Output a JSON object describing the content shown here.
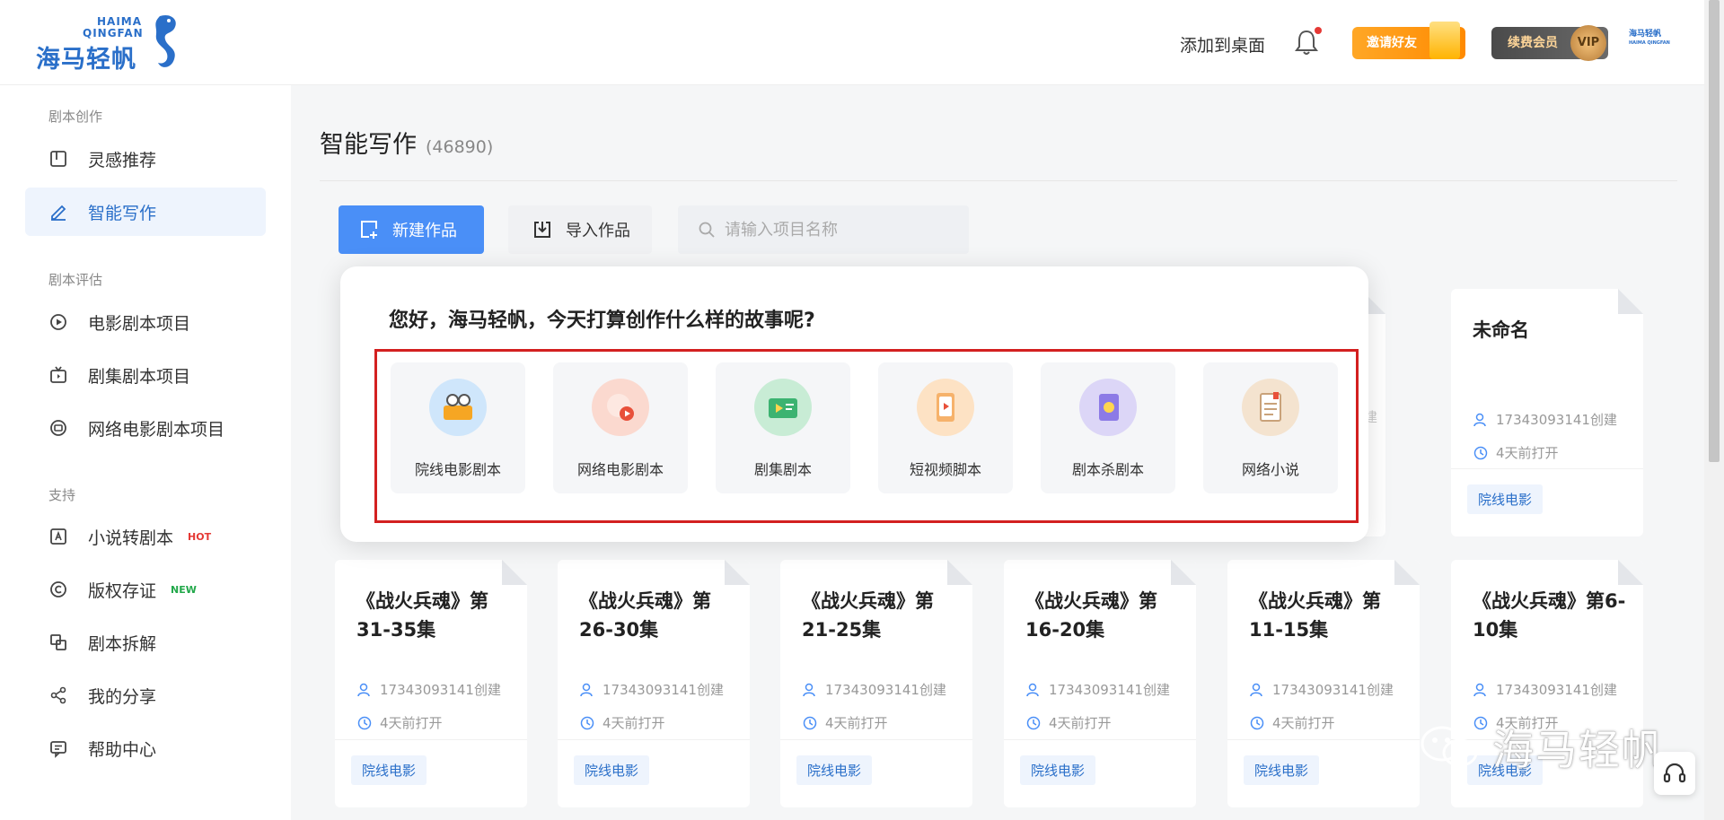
{
  "header": {
    "logo_cn": "海马轻帆",
    "logo_en_line1": "HAIMA",
    "logo_en_line2": "QINGFAN",
    "add_to_desktop": "添加到桌面",
    "invite_label": "邀请好友",
    "renew_label": "续费会员",
    "vip_badge": "VIP",
    "mini_logo_cn": "海马轻帆",
    "mini_logo_en": "HAIMA QINGFAN"
  },
  "sidebar": {
    "sections": [
      {
        "label": "剧本创作"
      },
      {
        "label": "剧本评估"
      },
      {
        "label": "支持"
      }
    ],
    "items": [
      {
        "label": "灵感推荐",
        "icon": "book-icon"
      },
      {
        "label": "智能写作",
        "icon": "pen-icon",
        "active": true
      },
      {
        "label": "电影剧本项目",
        "icon": "play-circle-icon"
      },
      {
        "label": "剧集剧本项目",
        "icon": "tv-icon"
      },
      {
        "label": "网络电影剧本项目",
        "icon": "web-video-icon"
      },
      {
        "label": "小说转剧本",
        "icon": "convert-icon",
        "tag": "HOT"
      },
      {
        "label": "版权存证",
        "icon": "copyright-icon",
        "tag": "NEW"
      },
      {
        "label": "剧本拆解",
        "icon": "split-icon"
      },
      {
        "label": "我的分享",
        "icon": "share-icon"
      },
      {
        "label": "帮助中心",
        "icon": "help-icon"
      }
    ]
  },
  "main": {
    "title": "智能写作",
    "count": "(46890)",
    "new_button": "新建作品",
    "import_button": "导入作品",
    "search_placeholder": "请输入项目名称"
  },
  "popup": {
    "greeting": "您好，海马轻帆，今天打算创作什么样的故事呢?",
    "options": [
      {
        "label": "院线电影剧本",
        "icon": "film-icon"
      },
      {
        "label": "网络电影剧本",
        "icon": "web-film-icon"
      },
      {
        "label": "剧集剧本",
        "icon": "tv-series-icon"
      },
      {
        "label": "短视频脚本",
        "icon": "short-video-icon"
      },
      {
        "label": "剧本杀剧本",
        "icon": "murder-mystery-icon"
      },
      {
        "label": "网络小说",
        "icon": "novel-icon"
      }
    ]
  },
  "cards_top": [
    {
      "title": "",
      "creator": "",
      "opened": "",
      "tag": ""
    },
    {
      "title": "",
      "creator": "",
      "opened": "",
      "tag": ""
    },
    {
      "title": "",
      "creator": "",
      "opened": "",
      "tag": ""
    },
    {
      "title": "",
      "creator": "",
      "opened": "",
      "tag": ""
    },
    {
      "title": "",
      "creator": "建",
      "opened": "",
      "tag": ""
    },
    {
      "title": "未命名",
      "creator": "17343093141创建",
      "opened": "4天前打开",
      "tag": "院线电影"
    }
  ],
  "cards_bottom": [
    {
      "title": "《战火兵魂》第31-35集",
      "creator": "17343093141创建",
      "opened": "4天前打开",
      "tag": "院线电影"
    },
    {
      "title": "《战火兵魂》第26-30集",
      "creator": "17343093141创建",
      "opened": "4天前打开",
      "tag": "院线电影"
    },
    {
      "title": "《战火兵魂》第21-25集",
      "creator": "17343093141创建",
      "opened": "4天前打开",
      "tag": "院线电影"
    },
    {
      "title": "《战火兵魂》第16-20集",
      "creator": "17343093141创建",
      "opened": "4天前打开",
      "tag": "院线电影"
    },
    {
      "title": "《战火兵魂》第11-15集",
      "creator": "17343093141创建",
      "opened": "4天前打开",
      "tag": "院线电影"
    },
    {
      "title": "《战火兵魂》第6-10集",
      "creator": "17343093141创建",
      "opened": "4天前打开",
      "tag": "院线电影"
    }
  ],
  "watermark": "海马轻帆"
}
